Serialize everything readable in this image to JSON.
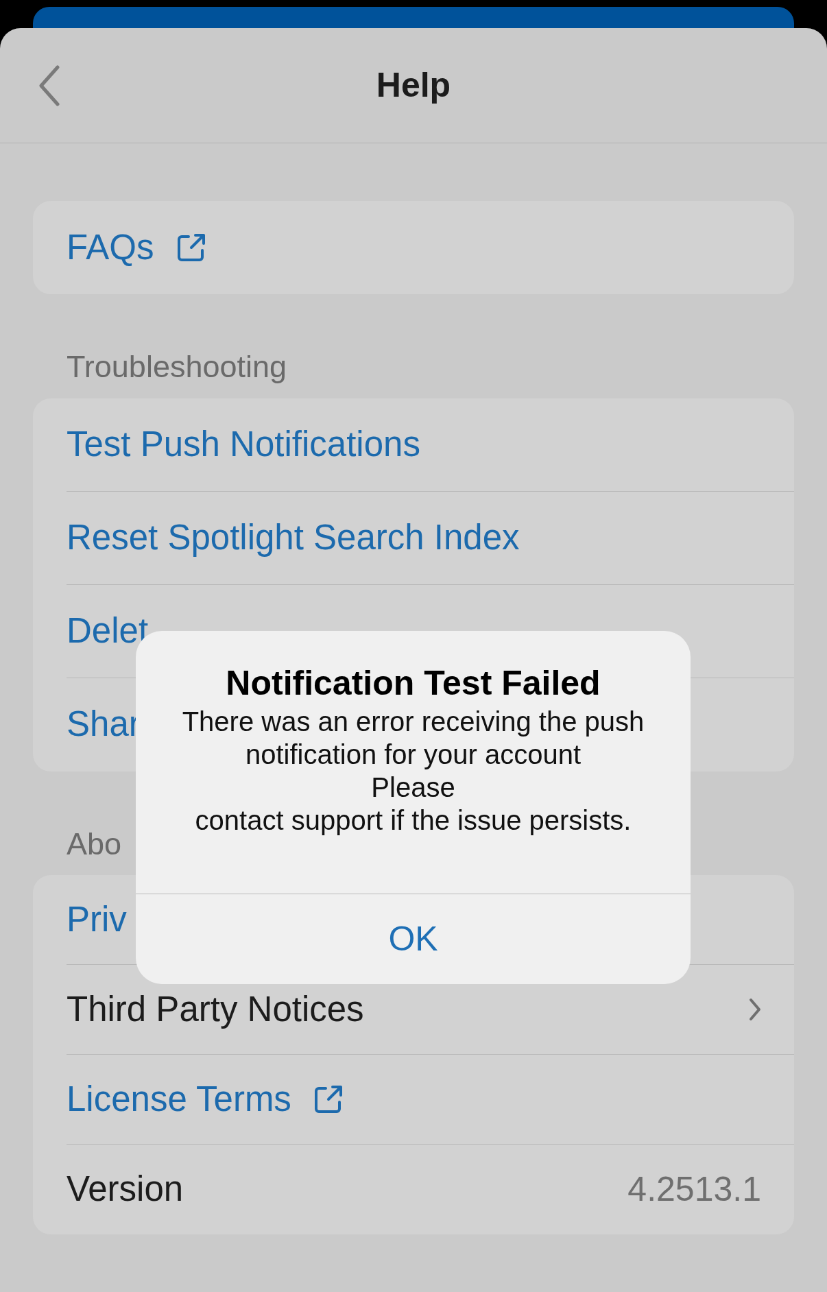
{
  "header": {
    "title": "Help"
  },
  "sections": [
    {
      "rows": [
        {
          "kind": "external_link",
          "label": "FAQs"
        }
      ]
    },
    {
      "title": "Troubleshooting",
      "rows": [
        {
          "kind": "link",
          "label": "Test Push Notifications"
        },
        {
          "kind": "link",
          "label": "Reset Spotlight Search Index"
        },
        {
          "kind": "link",
          "label": "Delet"
        },
        {
          "kind": "link",
          "label": "Shar"
        }
      ]
    },
    {
      "title": "Abo",
      "rows": [
        {
          "kind": "link",
          "label": "Priv"
        },
        {
          "kind": "disclosure",
          "label": "Third Party Notices"
        },
        {
          "kind": "external_link",
          "label": "License Terms"
        },
        {
          "kind": "value",
          "label": "Version",
          "value": "4.2513.1"
        }
      ]
    }
  ],
  "alert": {
    "title": "Notification Test Failed",
    "message_lines": [
      "There was an error receiving the push",
      "notification for your account",
      "Please",
      "contact support if the issue persists."
    ],
    "button": "OK"
  }
}
